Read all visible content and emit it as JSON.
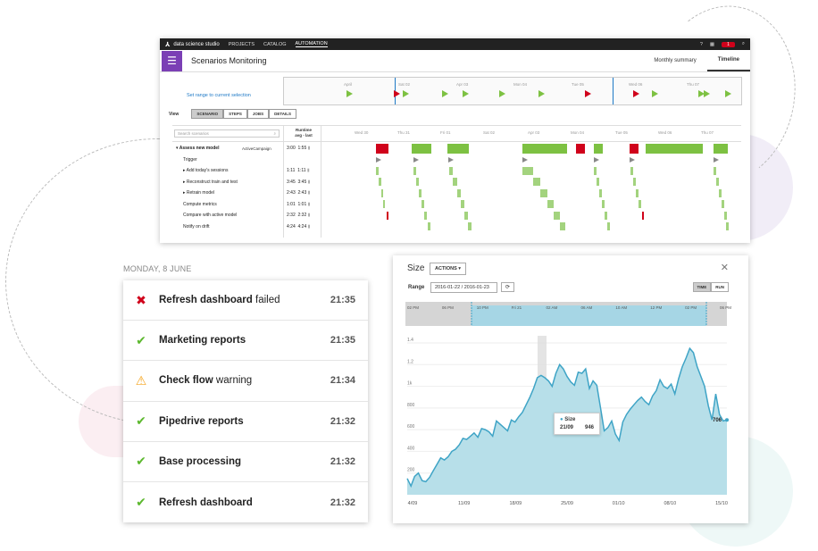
{
  "app": {
    "brand": "data science studio",
    "nav": [
      "PROJECTS",
      "CATALOG",
      "AUTOMATION"
    ],
    "notification_count": "1",
    "page_title": "Scenarios Monitoring",
    "tabs": [
      "Monthly summary",
      "Timeline"
    ],
    "range_link": "Set range to current selection",
    "range_ticks": [
      "April",
      "Sat 02",
      "Apr 03",
      "Mon 04",
      "Tue 05",
      "Wed 06",
      "Thu 07"
    ],
    "view_label": "View",
    "view_buttons": [
      "SCENARIO",
      "STEPS",
      "JOBS",
      "DETAILS"
    ],
    "search_placeholder": "Search scenarios",
    "runtime_header": "Runtime",
    "runtime_subheader": "avg - last",
    "col_ticks": [
      "Wed 30",
      "Thu 31",
      "Fri 01",
      "Sat 02",
      "Apr 03",
      "Mon 04",
      "Tue 05",
      "Wed 06",
      "Thu 07"
    ],
    "rows": [
      {
        "name": "Assess new model",
        "tag": "ActiveCampaign",
        "avg": "3:00",
        "last": "1:55"
      },
      {
        "name": "Trigger",
        "tag": "",
        "avg": "",
        "last": ""
      },
      {
        "name": "Add today's sessions",
        "tag": "",
        "avg": "1:11",
        "last": "1:11"
      },
      {
        "name": "Reconstruct train and test",
        "tag": "",
        "avg": "3:45",
        "last": "3:45"
      },
      {
        "name": "Retrain model",
        "tag": "",
        "avg": "2:43",
        "last": "2:43"
      },
      {
        "name": "Compute metrics",
        "tag": "",
        "avg": "1:01",
        "last": "1:01"
      },
      {
        "name": "Compare with active model",
        "tag": "",
        "avg": "2:32",
        "last": "2:32"
      },
      {
        "name": "Notify on drift",
        "tag": "",
        "avg": "4:24",
        "last": "4:24"
      }
    ]
  },
  "feed": {
    "day": "MONDAY, 8 JUNE",
    "items": [
      {
        "title": "Refresh dashboard",
        "suffix": " failed",
        "status": "fail",
        "time": "21:35"
      },
      {
        "title": "Marketing reports",
        "suffix": "",
        "status": "ok",
        "time": "21:35"
      },
      {
        "title": "Check flow",
        "suffix": " warning",
        "status": "warn",
        "time": "21:34"
      },
      {
        "title": "Pipedrive reports",
        "suffix": "",
        "status": "ok",
        "time": "21:32"
      },
      {
        "title": "Base processing",
        "suffix": "",
        "status": "ok",
        "time": "21:32"
      },
      {
        "title": "Refresh dashboard",
        "suffix": "",
        "status": "ok",
        "time": "21:32"
      }
    ]
  },
  "size_chart": {
    "title": "Size",
    "actions_label": "ACTIONS",
    "range_label": "Range",
    "range_value": "2016-01-22 / 2016-01-23",
    "toggle": [
      "TIME",
      "RUN"
    ],
    "overview_ticks": [
      "02 PM",
      "06 PM",
      "10 PM",
      "Fri 21",
      "02 AM",
      "06 AM",
      "10 AM",
      "12 PM",
      "02 PM",
      "06 PM"
    ],
    "tooltip": {
      "label": "Size",
      "date": "21/09",
      "value": "946"
    },
    "end_label": "706",
    "colors": {
      "area": "#b7dfe9",
      "line": "#3fa4c6"
    }
  },
  "chart_data": {
    "type": "area",
    "title": "",
    "xlabel": "",
    "ylabel": "",
    "x_ticks": [
      "4/09",
      "11/09",
      "18/09",
      "25/09",
      "01/10",
      "08/10",
      "15/10"
    ],
    "y_ticks": [
      "200",
      "400",
      "600",
      "800",
      "1k",
      "1.2",
      "1.4"
    ],
    "ylim": [
      0,
      1400
    ],
    "series": [
      {
        "values": [
          150,
          80,
          170,
          200,
          130,
          120,
          160,
          220,
          280,
          340,
          320,
          350,
          400,
          420,
          460,
          520,
          510,
          540,
          570,
          530,
          610,
          600,
          580,
          540,
          680,
          650,
          620,
          590,
          690,
          670,
          720,
          760,
          830,
          900,
          980,
          1080,
          1100,
          1080,
          1050,
          1000,
          1120,
          1200,
          1160,
          1090,
          1040,
          1010,
          1130,
          1120,
          1160,
          980,
          1050,
          1010,
          800,
          590,
          620,
          680,
          560,
          500,
          670,
          740,
          790,
          830,
          870,
          900,
          860,
          830,
          910,
          960,
          1060,
          1000,
          980,
          1020,
          930,
          1070,
          1180,
          1260,
          1350,
          1310,
          1180,
          1090,
          1000,
          820,
          690,
          930,
          740,
          680,
          690
        ]
      }
    ]
  }
}
